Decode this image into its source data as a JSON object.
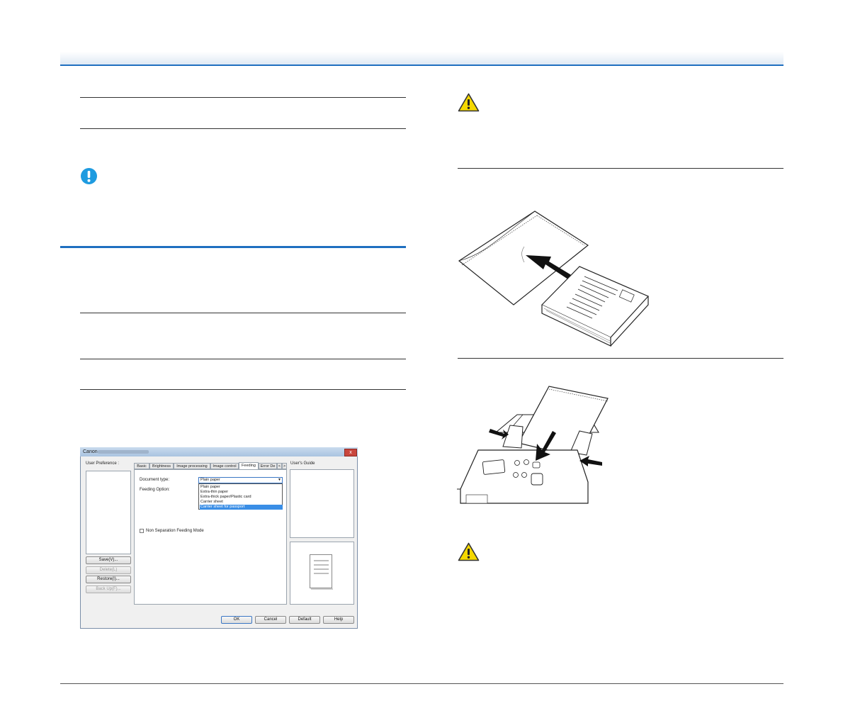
{
  "dialog": {
    "title": "Canon",
    "close_label": "x",
    "user_preference_label": "User Preference :",
    "users_guide_label": "User's Guide",
    "buttons": {
      "save": "Save(V)...",
      "delete": "Delete(L)",
      "restore": "Restore(I)...",
      "backup": "Back Up(F)...",
      "ok": "OK",
      "cancel": "Cancel",
      "default": "Default",
      "help": "Help"
    },
    "tabs": [
      "Basic",
      "Brightness",
      "Image processing",
      "Image control",
      "Feeding",
      "Error De"
    ],
    "tab_scroll": [
      "<",
      ">"
    ],
    "document_type_label": "Document type:",
    "feeding_option_label": "Feeding Option:",
    "document_type_value": "Plain paper",
    "document_type_options": [
      "Plain paper",
      "Extra-thin paper",
      "Extra-thick paper/Plastic card",
      "Carrier sheet",
      "Carrier sheet for passport"
    ],
    "selected_option_index": 4,
    "non_separation_label": "Non Separation Feeding Mode"
  },
  "icons": {
    "warning": "warning-triangle-icon",
    "important": "exclamation-circle-icon"
  },
  "colors": {
    "accent": "#1f6fc0",
    "warning_fill": "#f5d800",
    "important_fill": "#1e9be0"
  }
}
